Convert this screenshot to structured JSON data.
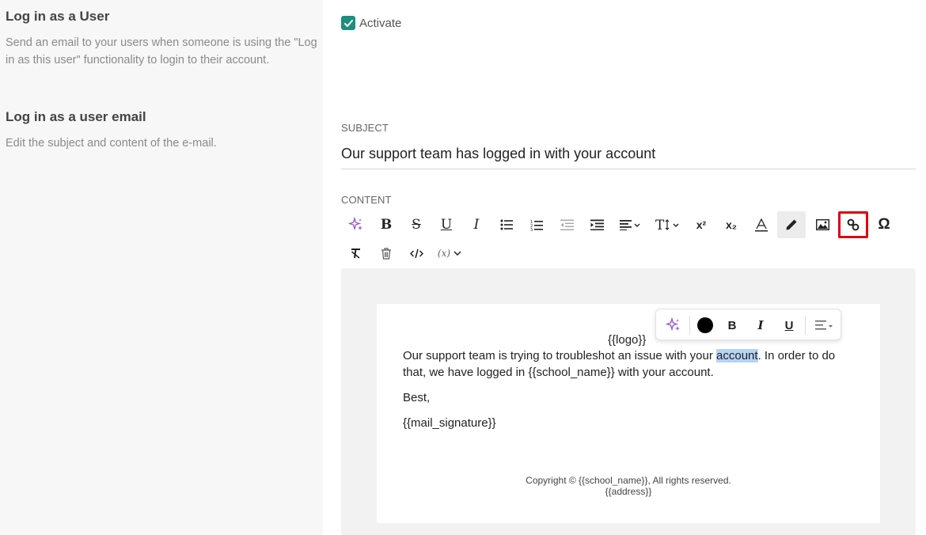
{
  "left": {
    "section1_title": "Log in as a User",
    "section1_desc": "Send an email to your users when someone is using the \"Log in as this user\" functionality to login to their account.",
    "section2_title": "Log in as a user email",
    "section2_desc": "Edit the subject and content of the e-mail."
  },
  "activate": {
    "label": "Activate",
    "checked": true
  },
  "subject": {
    "label": "SUBJECT",
    "value": "Our support team has logged in with your account"
  },
  "content": {
    "label": "CONTENT"
  },
  "toolbar": {
    "superscript": "x²",
    "subscript": "x₂",
    "variables": "(x)"
  },
  "email": {
    "logo": "{{logo}}",
    "body_before": "Our support team is trying to troubleshot an issue with your ",
    "body_selected": "account",
    "body_after": ". In order to do that, we have logged in {{school_name}} with your account.",
    "closing": "Best,",
    "signature": "{{mail_signature}}",
    "copyright": "Copyright © {{school_name}}, All rights reserved.",
    "address": "{{address}}"
  },
  "colors": {
    "accent": "#1e8e7e",
    "highlight_border": "#e0000f",
    "selection": "#b5d3f5",
    "ai_icon": "#9b59d0"
  }
}
